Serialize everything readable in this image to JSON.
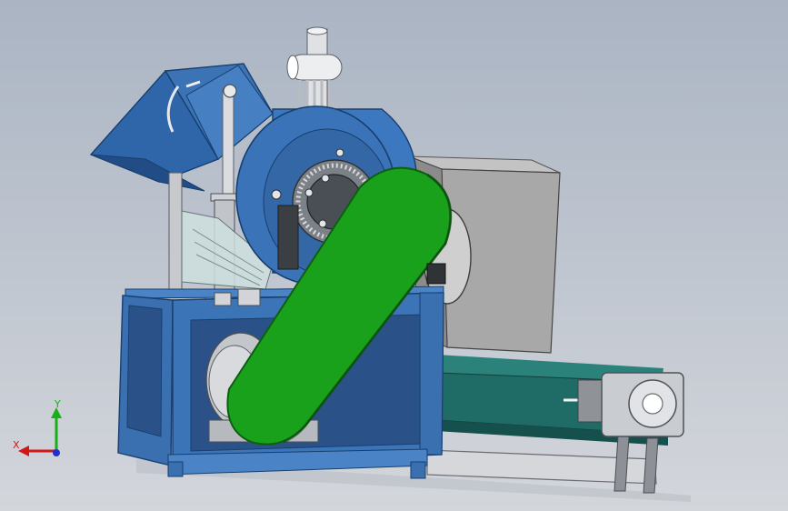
{
  "viewport": {
    "background_top": "#aab4c3",
    "background_bottom": "#d3d6db"
  },
  "model": {
    "colors": {
      "frame_blue": "#3a6fb0",
      "frame_dark": "#2a5289",
      "belt_green": "#19a11b",
      "belt_edge": "#0d5f10",
      "gray_box": "#a8a8a8",
      "conveyor_teal": "#1f6c67",
      "metal": "#c9ccd1",
      "dark_metal": "#555a60"
    }
  },
  "triad": {
    "x_label": "X",
    "y_label": "Y",
    "x_color": "#d01818",
    "y_color": "#18b018",
    "z_color": "#2030d0"
  }
}
